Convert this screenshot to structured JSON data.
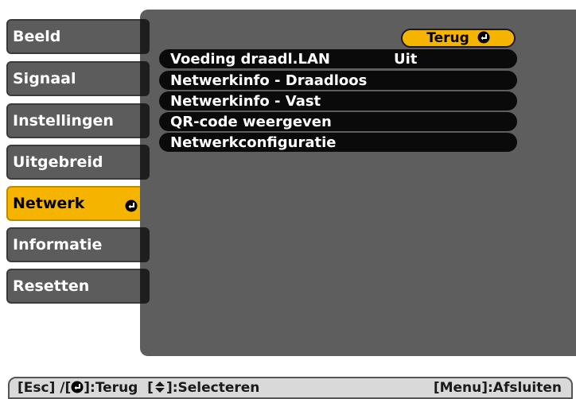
{
  "tabs": [
    {
      "label": "Beeld",
      "active": false
    },
    {
      "label": "Signaal",
      "active": false
    },
    {
      "label": "Instellingen",
      "active": false
    },
    {
      "label": "Uitgebreid",
      "active": false
    },
    {
      "label": "Netwerk",
      "active": true
    },
    {
      "label": "Informatie",
      "active": false
    },
    {
      "label": "Resetten",
      "active": false
    }
  ],
  "panel": {
    "back_label": "Terug",
    "items": [
      {
        "label": "Voeding draadl.LAN",
        "value": "Uit"
      },
      {
        "label": "Netwerkinfo - Draadloos",
        "value": ""
      },
      {
        "label": "Netwerkinfo - Vast",
        "value": ""
      },
      {
        "label": "QR-code weergeven",
        "value": ""
      },
      {
        "label": "Netwerkconfiguratie",
        "value": ""
      }
    ]
  },
  "status_bar": {
    "esc_part": "[Esc] /[",
    "back_part": "]:Terug  [",
    "select_part": "]:Selecteren",
    "exit_label": "[Menu]:Afsluiten"
  },
  "colors": {
    "accent": "#f5b400",
    "tab_bg": "#5c5c5c",
    "panel_bg": "#5e5e5e",
    "row_bg": "#0a0a0a"
  },
  "icons": {
    "enter": "enter-icon",
    "updown": "updown-icon"
  }
}
